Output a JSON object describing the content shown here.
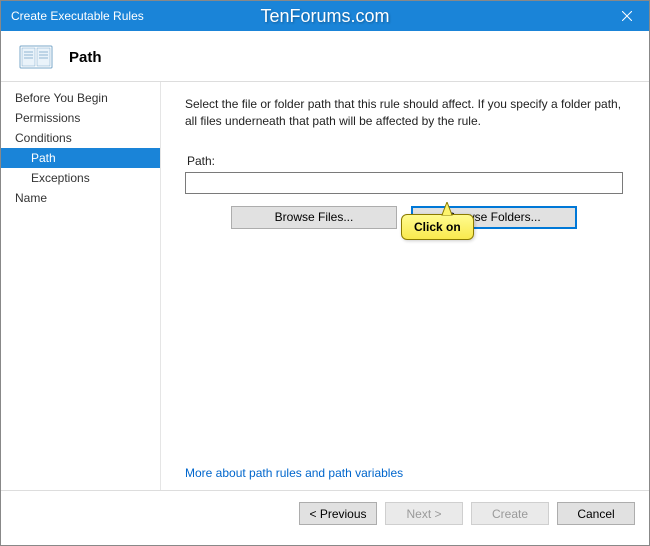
{
  "window": {
    "title": "Create Executable Rules",
    "watermark": "TenForums.com"
  },
  "header": {
    "title": "Path"
  },
  "sidebar": {
    "items": [
      {
        "label": "Before You Begin",
        "sub": false,
        "selected": false
      },
      {
        "label": "Permissions",
        "sub": false,
        "selected": false
      },
      {
        "label": "Conditions",
        "sub": false,
        "selected": false
      },
      {
        "label": "Path",
        "sub": true,
        "selected": true
      },
      {
        "label": "Exceptions",
        "sub": true,
        "selected": false
      },
      {
        "label": "Name",
        "sub": false,
        "selected": false
      }
    ]
  },
  "main": {
    "instructions": "Select the file or folder path that this rule should affect. If you specify a folder path, all files underneath that path will be affected by the rule.",
    "path_label": "Path:",
    "path_value": "",
    "browse_files_label": "Browse Files...",
    "browse_folders_label": "Browse Folders...",
    "more_link": "More about path rules and path variables"
  },
  "callout": {
    "text": "Click on"
  },
  "footer": {
    "previous": "< Previous",
    "next": "Next >",
    "create": "Create",
    "cancel": "Cancel"
  }
}
